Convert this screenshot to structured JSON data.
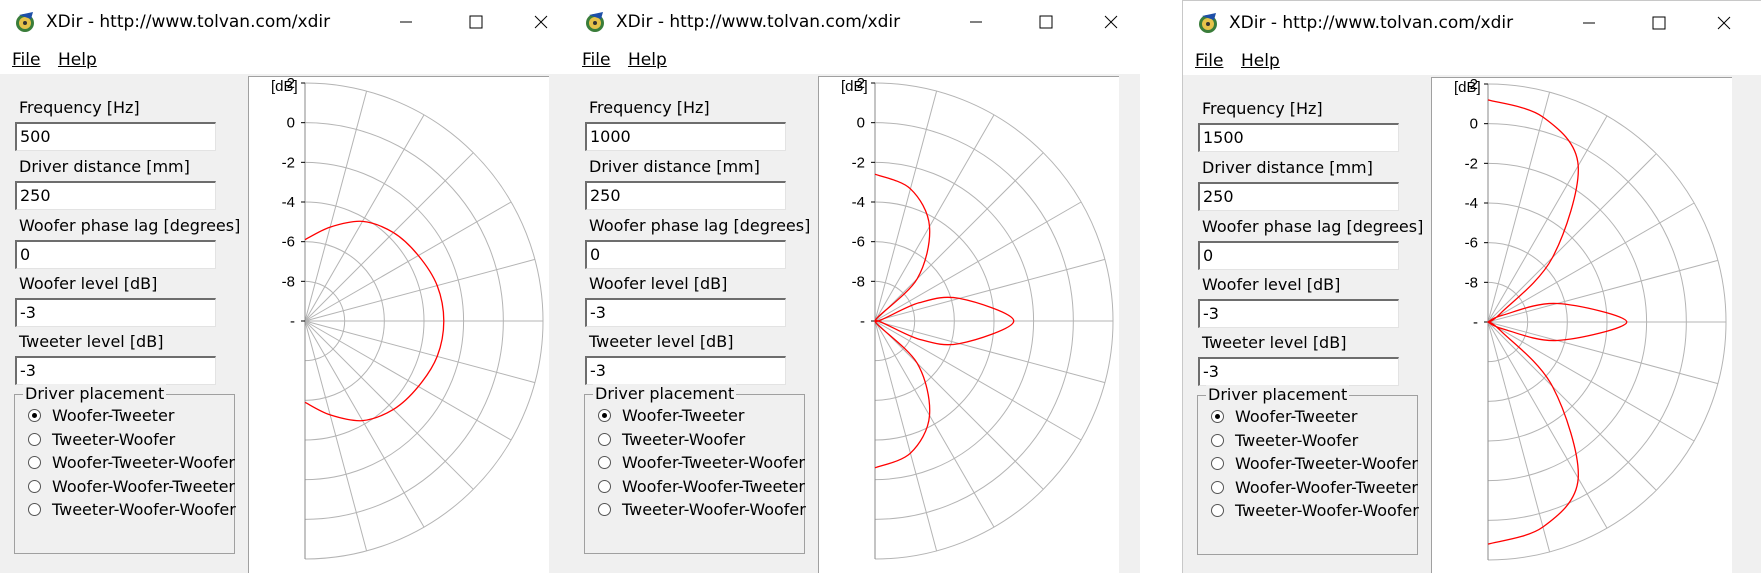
{
  "app": {
    "title": "XDir - http://www.tolvan.com/xdir",
    "menu": {
      "file": "File",
      "help": "Help"
    }
  },
  "labels": {
    "frequency": "Frequency [Hz]",
    "driver_distance": "Driver distance [mm]",
    "woofer_phase": "Woofer phase lag [degrees]",
    "woofer_level": "Woofer level [dB]",
    "tweeter_level": "Tweeter level [dB]",
    "placement": "Driver placement"
  },
  "placement_options": [
    "Woofer-Tweeter",
    "Tweeter-Woofer",
    "Woofer-Tweeter-Woofer",
    "Woofer-Woofer-Tweeter",
    "Tweeter-Woofer-Woofer"
  ],
  "windows": [
    {
      "frequency": "500",
      "driver_distance": "250",
      "woofer_phase": "0",
      "woofer_level": "-3",
      "tweeter_level": "-3",
      "selected_placement": "Woofer-Tweeter"
    },
    {
      "frequency": "1000",
      "driver_distance": "250",
      "woofer_phase": "0",
      "woofer_level": "-3",
      "tweeter_level": "-3",
      "selected_placement": "Woofer-Tweeter"
    },
    {
      "frequency": "1500",
      "driver_distance": "250",
      "woofer_phase": "0",
      "woofer_level": "-3",
      "tweeter_level": "-3",
      "selected_placement": "Woofer-Tweeter"
    }
  ],
  "chart_data": [
    {
      "type": "polar-line",
      "unit_label": "[dB]",
      "r_ticks": [
        "2",
        "0",
        "-2",
        "-4",
        "-6",
        "-8",
        "-"
      ],
      "r_range": [
        -10,
        2
      ],
      "series": [
        {
          "color": "#ff0000",
          "angles_deg": [
            90,
            75,
            60,
            45,
            30,
            15,
            0,
            -15,
            -30,
            -45,
            -60,
            -75,
            -90
          ],
          "values_db": [
            -5.9,
            -5.1,
            -4.2,
            -3.7,
            -3.4,
            -3.1,
            -3.0,
            -3.1,
            -3.4,
            -3.7,
            -4.2,
            -5.1,
            -5.9
          ]
        }
      ]
    },
    {
      "type": "polar-line",
      "unit_label": "[dB]",
      "r_ticks": [
        "2",
        "0",
        "-2",
        "-4",
        "-6",
        "-8",
        "-"
      ],
      "r_range": [
        -10,
        2
      ],
      "series": [
        {
          "color": "#ff0000",
          "angles_deg": [
            90,
            75,
            60,
            45,
            30,
            22.5,
            15,
            0,
            -15,
            -22.5,
            -30,
            -45,
            -60,
            -75,
            -90
          ],
          "values_db": [
            -2.6,
            -3.1,
            -4.5,
            -7.0,
            -10.0,
            -7.6,
            -5.6,
            -3.0,
            -5.6,
            -7.6,
            -10.0,
            -7.0,
            -4.5,
            -3.1,
            -2.6
          ]
        }
      ]
    },
    {
      "type": "polar-line",
      "unit_label": "[dB]",
      "r_ticks": [
        "2",
        "0",
        "-2",
        "-4",
        "-6",
        "-8",
        "-"
      ],
      "r_range": [
        -10,
        2
      ],
      "series": [
        {
          "color": "#ff0000",
          "angles_deg": [
            90,
            75,
            60,
            45,
            35,
            30,
            25,
            15,
            0,
            -15,
            -25,
            -30,
            -35,
            -45,
            -60,
            -75,
            -90
          ],
          "values_db": [
            1.2,
            0.7,
            -0.9,
            -5.4,
            -9.2,
            -10.0,
            -9.2,
            -6.4,
            -3.0,
            -6.4,
            -9.2,
            -10.0,
            -9.2,
            -5.4,
            -0.9,
            0.7,
            1.2
          ]
        }
      ]
    }
  ]
}
